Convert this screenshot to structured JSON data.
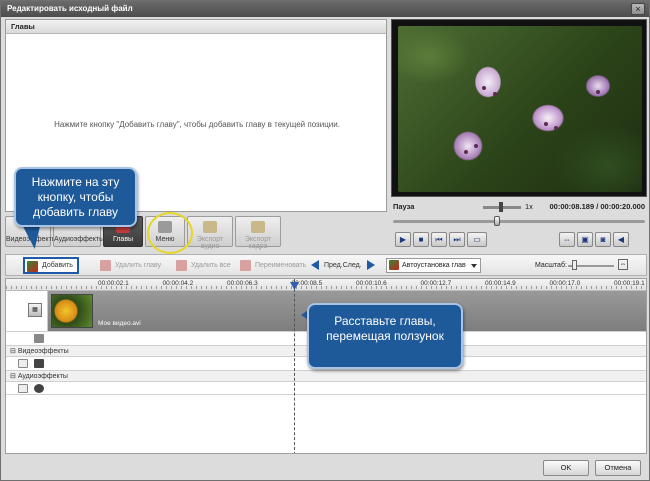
{
  "window": {
    "title": "Редактировать исходный файл",
    "close_glyph": "×"
  },
  "chapters_panel": {
    "header": "Главы",
    "hint": "Нажмите кнопку \"Добавить главу\", чтобы добавить главу в текущей позиции."
  },
  "player": {
    "status": "Пауза",
    "speed": "1x",
    "time": "00:00:08.189 / 00:00:20.000",
    "current_fraction": 0.41,
    "buttons": [
      {
        "name": "play-icon",
        "glyph": "▶"
      },
      {
        "name": "stop-icon",
        "glyph": "■"
      },
      {
        "name": "prev-frame-icon",
        "glyph": "⏮"
      },
      {
        "name": "next-frame-icon",
        "glyph": "⏭"
      },
      {
        "name": "fullscreen-icon",
        "glyph": "▭"
      }
    ],
    "right_buttons": [
      {
        "name": "aspect-ratio-icon",
        "glyph": "⇔"
      },
      {
        "name": "snapshot-icon",
        "glyph": "▣"
      },
      {
        "name": "camera-icon",
        "glyph": "◙"
      },
      {
        "name": "volume-icon",
        "glyph": "◀"
      }
    ]
  },
  "tabs": [
    {
      "label": "Видеоэффекты",
      "state": "normal"
    },
    {
      "label": "Аудиоэффекты",
      "state": "normal"
    },
    {
      "label": "Главы",
      "state": "active"
    },
    {
      "label": "Меню",
      "state": "normal"
    },
    {
      "label": "Экспорт аудио",
      "state": "disabled"
    },
    {
      "label": "Экспорт кадра",
      "state": "disabled"
    }
  ],
  "toolbar": {
    "add": "Добавить",
    "delete": "Удалить главу",
    "delete_all": "Удалить все",
    "rename": "Переименовать",
    "prev_next": "Пред.След.",
    "auto": "Автоустановка глав",
    "zoom_label": "Масштаб:",
    "zoom_level": 0.1
  },
  "timeline": {
    "ticks": [
      "00:00:02.1",
      "00:00:04.2",
      "00:00:06.3",
      "00:00:08.5",
      "00:00:10.6",
      "00:00:12.7",
      "00:00:14.9",
      "00:00:17.0",
      "00:00:19.1"
    ],
    "clip_name": "Мое видео.avi",
    "video_effects": "Видеоэффекты",
    "audio_effects": "Аудиоэффекты",
    "collapse_glyph": "⊟"
  },
  "callouts": {
    "add_hint": "Нажмите на эту кнопку, чтобы добавить главу",
    "slider_hint": "Расставьте главы, перемещая ползунок"
  },
  "footer": {
    "ok": "OK",
    "cancel": "Отмена"
  },
  "colors": {
    "accent": "#1e5a9a",
    "highlight": "#e7d62a",
    "active_tab": "#3b3b3b"
  }
}
